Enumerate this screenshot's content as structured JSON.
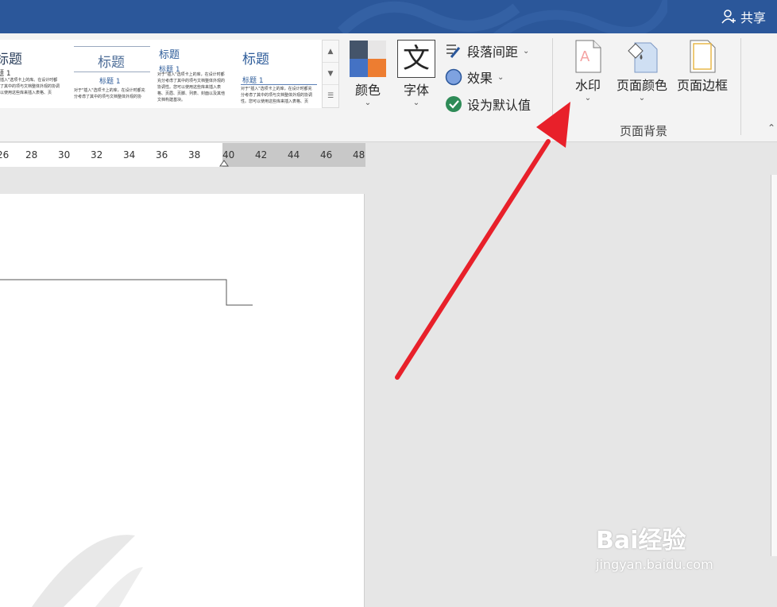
{
  "titlebar": {
    "share_label": "共享",
    "color": "#2b579a"
  },
  "styles_gallery": {
    "items": [
      {
        "title": "标题",
        "subtitle": "题 1",
        "body": "插入\"选项卡上的库。在设计时都\n了其中的项与文档整体外观的协调\n以使用这些库来插入表格、页"
      },
      {
        "title": "标题",
        "subtitle": "标题 1",
        "body": "对于\"插入\"选项卡上的库，在设计时都充\n分考虑了其中的项与文档整体外观的协"
      },
      {
        "title": "标题",
        "subtitle": "标题 1",
        "body": "对于\"插入\"选项卡上的库，在设计时都\n充分考虑了其中的项与文档整体外观的\n协调性。您可以使用这些库来插入表\n格、页眉、页脚、列表、封面以及其他\n文档构建基块。"
      },
      {
        "title": "标题",
        "subtitle": "标题 1",
        "body": "对于\"插入\"选项卡上的库，在设计时都充\n分考虑了其中的项与文档整体外观的协调\n性。您可以使用这些库来插入表格、页"
      }
    ]
  },
  "design": {
    "colors_label": "颜色",
    "fonts_label": "字体",
    "fonts_glyph": "文",
    "paragraph_spacing_label": "段落间距",
    "effects_label": "效果",
    "set_default_label": "设为默认值"
  },
  "page_background": {
    "group_label": "页面背景",
    "watermark_label": "水印",
    "page_color_label": "页面颜色",
    "page_borders_label": "页面边框"
  },
  "ruler": {
    "ticks": [
      "26",
      "28",
      "30",
      "32",
      "34",
      "36",
      "38",
      "40",
      "42",
      "44",
      "46",
      "48"
    ]
  },
  "watermark_brand": {
    "brand": "Bai经验",
    "url": "jingyan.baidu.com"
  },
  "colors": {
    "accent": "#2b579a",
    "arrow": "#e8202a"
  }
}
